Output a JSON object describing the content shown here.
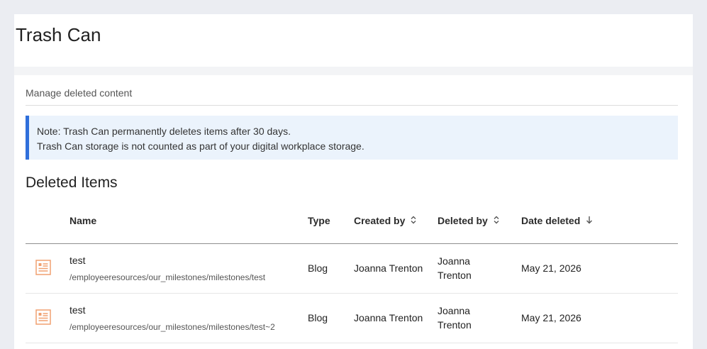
{
  "header": {
    "title": "Trash Can"
  },
  "subtitle": "Manage deleted content",
  "notice": {
    "line1": "Note: Trash Can permanently deletes items after 30 days.",
    "line2": "Trash Can storage is not counted as part of your digital workplace storage."
  },
  "section_title": "Deleted Items",
  "table": {
    "columns": {
      "name": "Name",
      "type": "Type",
      "created_by": "Created by",
      "deleted_by": "Deleted by",
      "date_deleted": "Date deleted"
    },
    "rows": [
      {
        "icon": "blog-document-icon",
        "title": "test",
        "path": "/employeeresources/our_milestones/milestones/test",
        "type": "Blog",
        "created_by": "Joanna Trenton",
        "deleted_by": "Joanna Trenton",
        "date_deleted": "May 21, 2026"
      },
      {
        "icon": "blog-document-icon",
        "title": "test",
        "path": "/employeeresources/our_milestones/milestones/test~2",
        "type": "Blog",
        "created_by": "Joanna Trenton",
        "deleted_by": "Joanna Trenton",
        "date_deleted": "May 21, 2026"
      }
    ]
  },
  "colors": {
    "accent": "#2f6fdb",
    "notice_bg": "#ebf3fc",
    "item_icon": "#f0a070"
  }
}
